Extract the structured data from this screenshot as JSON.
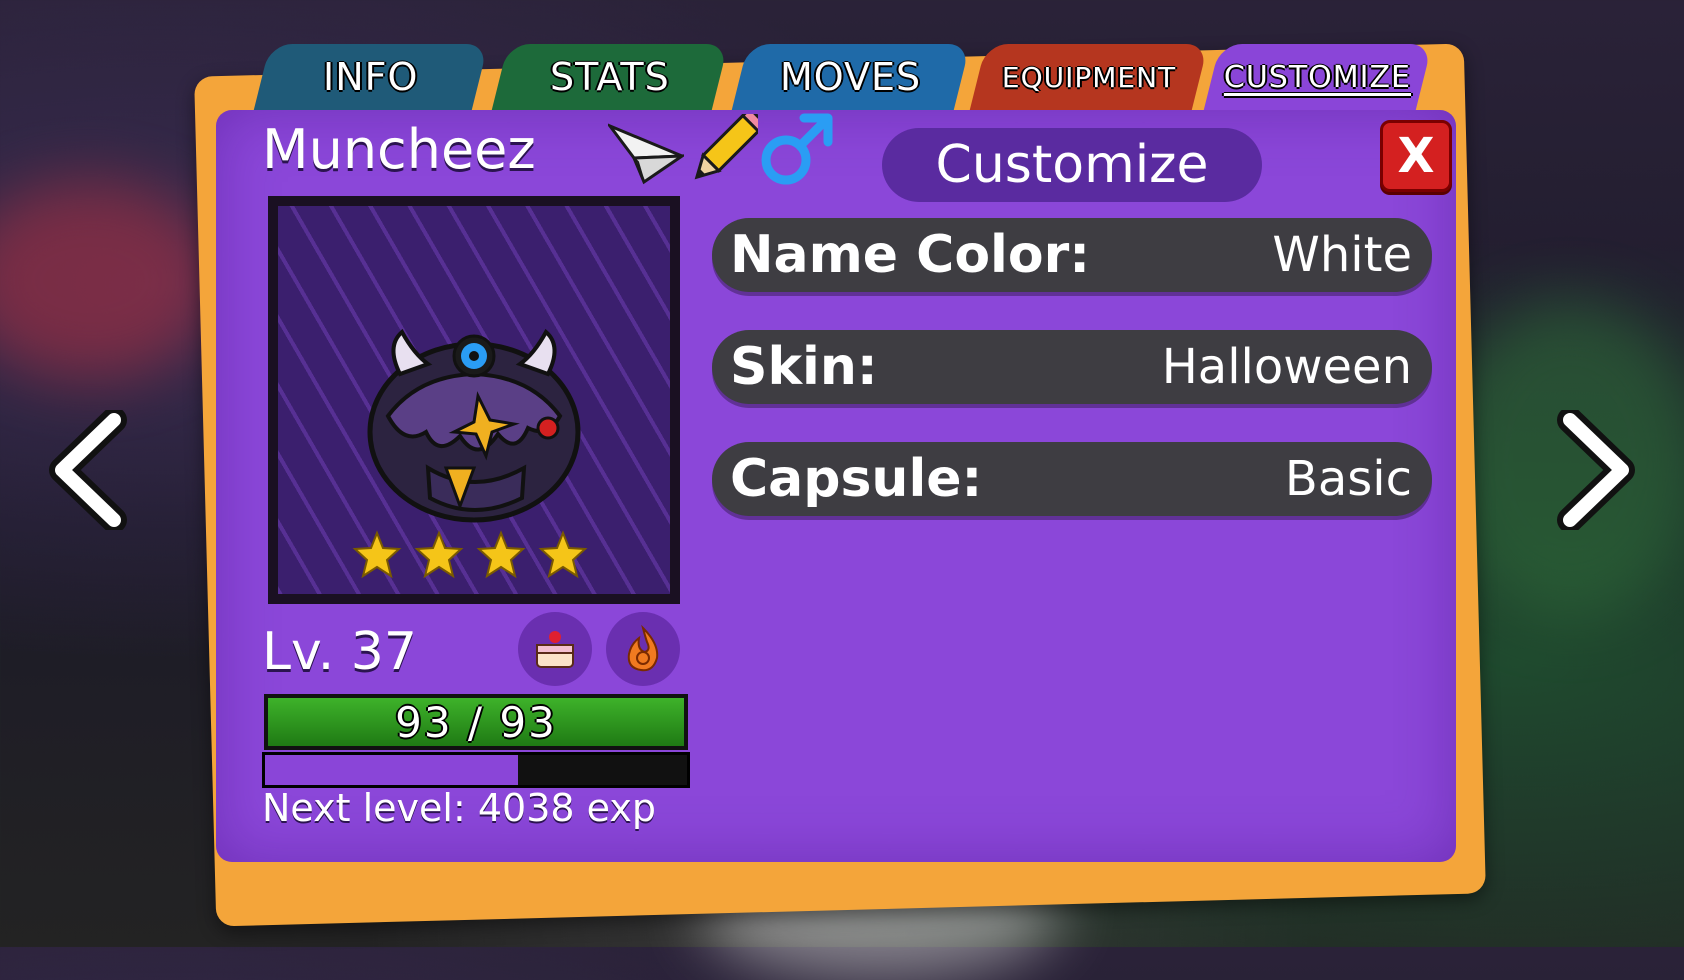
{
  "tabs": [
    {
      "label": "INFO"
    },
    {
      "label": "STATS"
    },
    {
      "label": "MOVES"
    },
    {
      "label": "EQUIPMENT"
    },
    {
      "label": "CUSTOMIZE",
      "active": true
    }
  ],
  "pet": {
    "name": "Muncheez",
    "stars": 4,
    "gender_icon": "male-symbol-icon",
    "level": "Lv. 37",
    "hp_text": "93 / 93",
    "hp_current": 93,
    "hp_max": 93,
    "exp_fraction": 0.6,
    "next_level": "Next level: 4038 exp",
    "held_item_icon": "cake-icon",
    "ability_icon": "flame-swirl-icon"
  },
  "customize": {
    "title": "Customize",
    "close_label": "X",
    "options": [
      {
        "label": "Name Color:",
        "value": "White"
      },
      {
        "label": "Skin:",
        "value": "Halloween"
      },
      {
        "label": "Capsule:",
        "value": "Basic"
      }
    ]
  },
  "colors": {
    "panel": "#8b47d9",
    "back_card": "#f4a53a",
    "hp_green": "#3eb22a",
    "close_red": "#d42020",
    "gender_blue": "#2a9df4",
    "star_yellow": "#f5c518"
  }
}
